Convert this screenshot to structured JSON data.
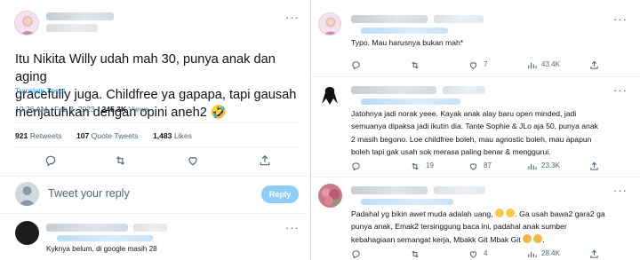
{
  "main_tweet": {
    "text_lines": [
      "Itu Nikita Willy udah mah 30, punya anak dan aging",
      "gracefully juga. Childfree ya gapapa, tapi gausah",
      "menjatuhkan dengan opini aneh2 🤣"
    ],
    "translate": "Translate Tweet",
    "time": "10:26 AM · Feb 7, 2023 · ",
    "views_count": "245.3K",
    "views_label": " Views",
    "retweets_count": "921",
    "retweets_label": " Retweets",
    "quotes_count": "107",
    "quotes_label": " Quote Tweets",
    "likes_count": "1,483",
    "likes_label": " Likes",
    "more": "···"
  },
  "composer": {
    "placeholder": "Tweet your reply",
    "reply_button": "Reply"
  },
  "left_reply": {
    "text": "Kyknya belum, di google masih 28",
    "more": "···"
  },
  "right_replies": [
    {
      "lines": [
        "Typo. Mau harusnya bukan mah*"
      ],
      "retweets": "",
      "likes": "7",
      "views": "43.4K",
      "more": "···"
    },
    {
      "lines": [
        "Jatohnya jadi norak yeee. Kayak anak alay baru open minded, jadi",
        "semuanya dipaksa jadi ikutin dia.  Tante Sophie & JLo aja 50, punya anak",
        "2 masih begono. Loe childfree boleh, mau agnostic boleh, mau apapun",
        "boleh tapi gak usah sok merasa paling benar & menggurui."
      ],
      "retweets": "19",
      "likes": "87",
      "views": "23.3K",
      "more": "···"
    },
    {
      "lines": [
        "Padahal yg bikin awet muda adalah uang,",
        "punya anak, Emak2 tersinggung baca ini, padahal anak sumber",
        "kebahagiaan semangat kerja, Mbakk Git Mbak Git"
      ],
      "line1_tail": "Ga usah bawa2 gara2 ga",
      "retweets": "",
      "likes": "4",
      "views": "28.4K",
      "more": "···"
    }
  ],
  "colors": {
    "accent": "#1d9bf0",
    "reply_button": "#8ecdf8",
    "muted": "#536471",
    "text": "#0f1419"
  }
}
